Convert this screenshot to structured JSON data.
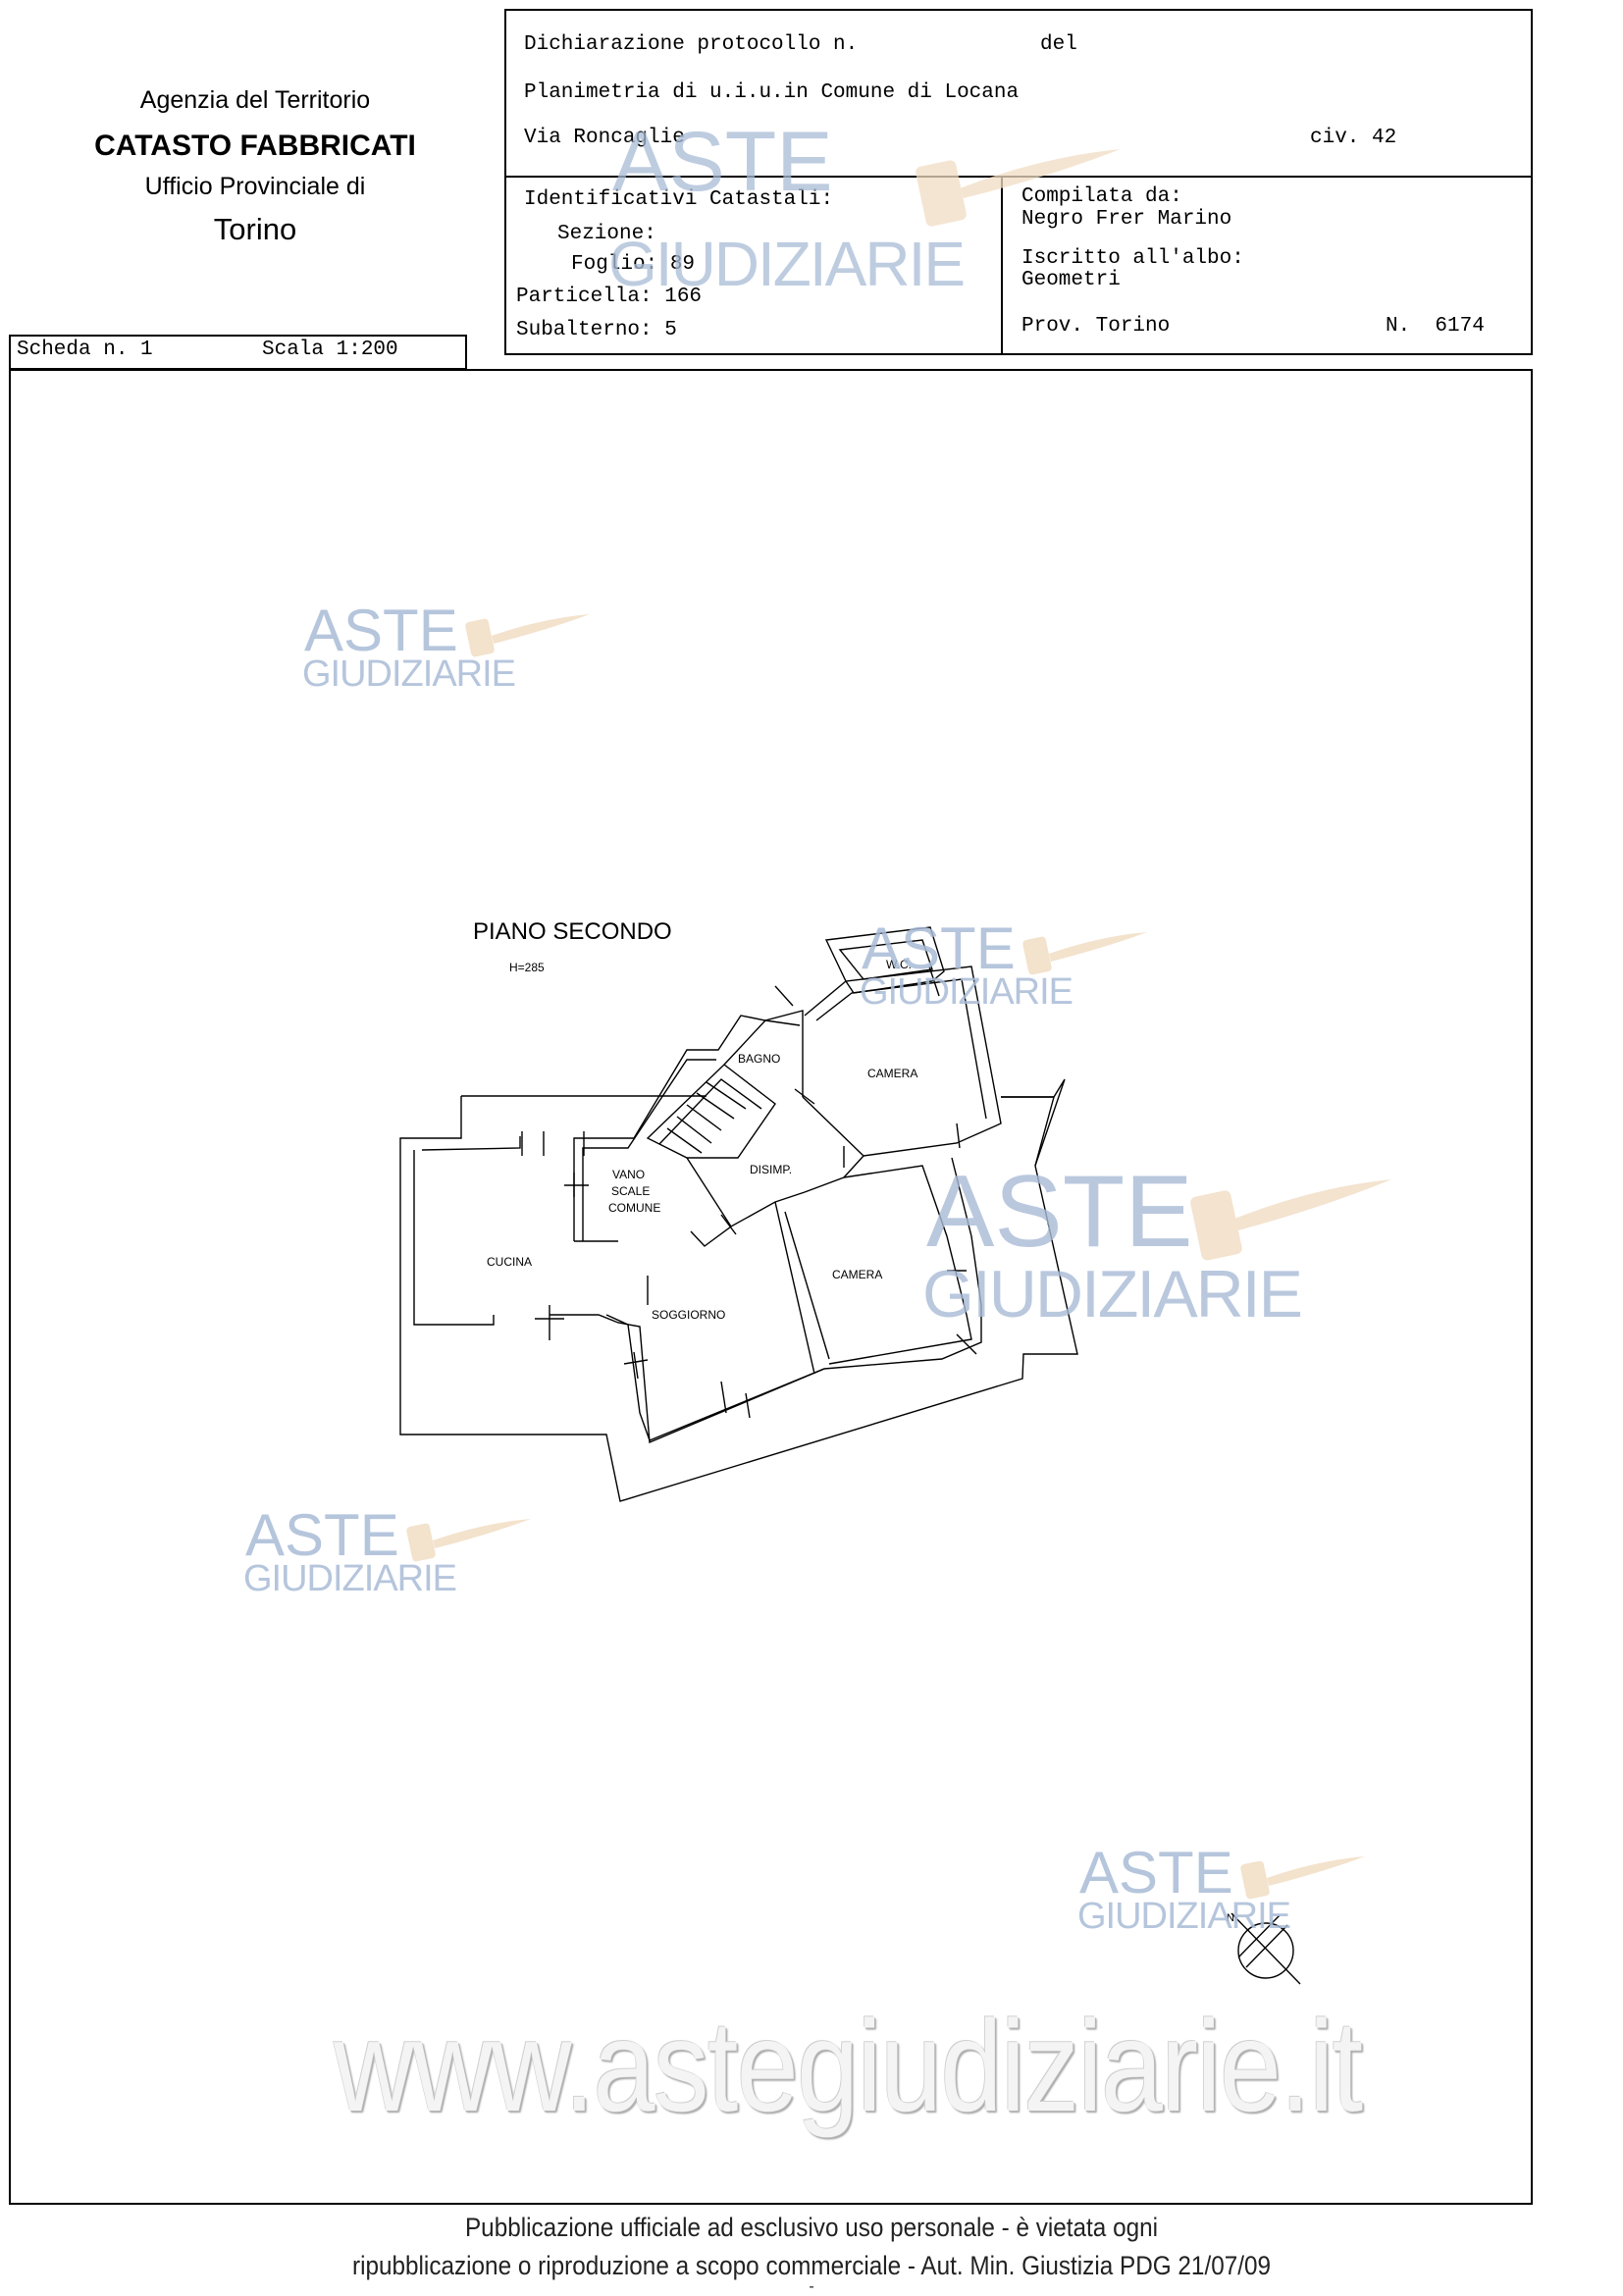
{
  "header_left": {
    "line1": "Agenzia del Territorio",
    "line2": "CATASTO FABBRICATI",
    "line3": "Ufficio Provinciale di",
    "line4": "Torino"
  },
  "declaration": {
    "protocol_label": "Dichiarazione protocollo n.",
    "del_label": "del",
    "planimetria": "Planimetria di u.i.u.in Comune di Locana",
    "via": "Via Roncaglie",
    "civ": "civ. 42"
  },
  "identifiers": {
    "title": "Identificativi Catastali:",
    "sezione": "Sezione:",
    "foglio": "Foglio: 89",
    "particella": "Particella: 166",
    "subalterno": "Subalterno: 5"
  },
  "compiler": {
    "label": "Compilata da:",
    "name": "Negro Frer Marino",
    "albo_label": "Iscritto all'albo:",
    "albo": "Geometri",
    "prov": "Prov. Torino",
    "number": "N.  6174"
  },
  "scheda": {
    "scheda": "Scheda n. 1",
    "scala": "Scala 1:200"
  },
  "plan": {
    "title": "PIANO SECONDO",
    "height": "H=285",
    "rooms": {
      "wc": "W.C.",
      "bagno": "BAGNO",
      "camera1": "CAMERA",
      "vano1": "VANO",
      "vano2": "SCALE",
      "vano3": "COMUNE",
      "disimp": "DISIMP.",
      "cucina": "CUCINA",
      "soggiorno": "SOGGIORNO",
      "camera2": "CAMERA"
    },
    "north": "N"
  },
  "watermark": {
    "aste": "ASTE",
    "giudiziarie": "GIUDIZIARIE",
    "url": "www.astegiudiziarie.it"
  },
  "footer": {
    "line1": "Pubblicazione ufficiale ad esclusivo uso personale - è vietata ogni",
    "line2": "ripubblicazione o riproduzione a scopo commerciale - Aut. Min. Giustizia PDG 21/07/09",
    "line3": "-"
  },
  "colors": {
    "watermark_blue": "#a9bbd6",
    "watermark_gavel": "#f1ddc4"
  }
}
